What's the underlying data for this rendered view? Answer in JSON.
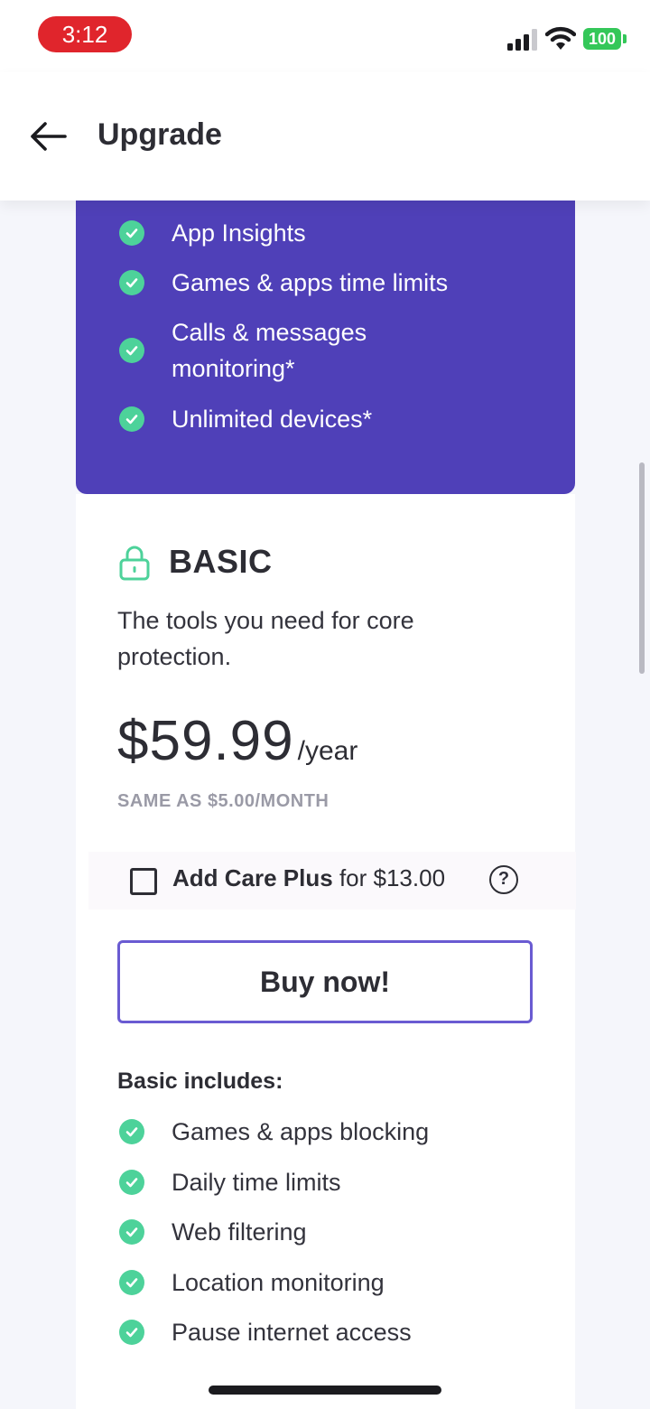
{
  "status_bar": {
    "time": "3:12",
    "battery": "100"
  },
  "header": {
    "title": "Upgrade"
  },
  "premium": {
    "features": [
      {
        "label": "App Insights"
      },
      {
        "label": "Games & apps time limits"
      },
      {
        "label": "Calls & messages monitoring*"
      },
      {
        "label": "Unlimited devices*"
      }
    ]
  },
  "basic": {
    "title": "BASIC",
    "description": "The tools you need for core protection.",
    "price": "$59.99",
    "period": "/year",
    "monthly_note": "SAME AS $5.00/MONTH",
    "care_plus": {
      "bold": "Add Care Plus",
      "rest": " for $13.00",
      "checked": false
    },
    "buy_label": "Buy now!",
    "includes_title": "Basic includes:",
    "features": [
      {
        "label": "Games & apps blocking"
      },
      {
        "label": "Daily time limits"
      },
      {
        "label": "Web filtering"
      },
      {
        "label": "Location monitoring"
      },
      {
        "label": "Pause internet access"
      }
    ]
  },
  "colors": {
    "accent": "#4f40b8",
    "check": "#4dd29a",
    "button_border": "#6a5bd2",
    "time_pill": "#e0252c"
  }
}
